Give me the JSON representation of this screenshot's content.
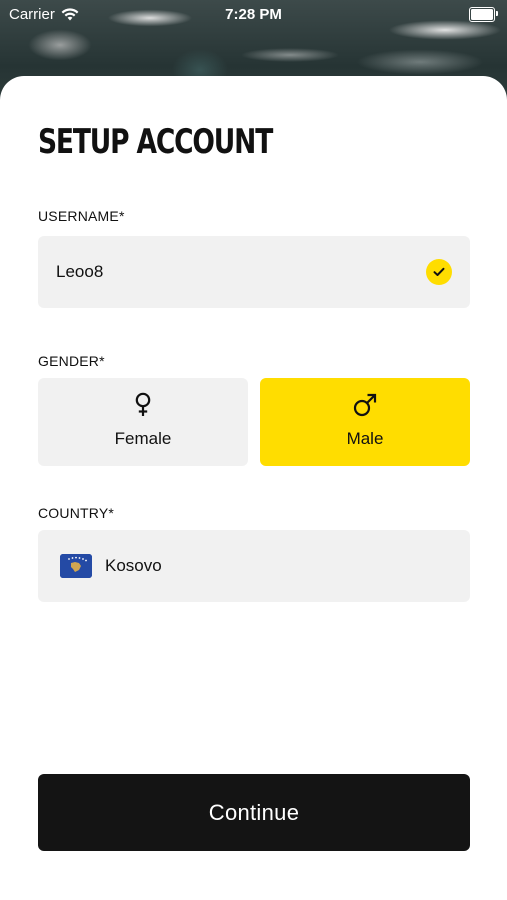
{
  "status_bar": {
    "carrier": "Carrier",
    "time": "7:28 PM",
    "wifi_icon": "wifi-icon",
    "battery_icon": "battery-icon"
  },
  "screen": {
    "title": "SETUP ACCOUNT"
  },
  "username": {
    "label": "USERNAME*",
    "value": "Leoo8",
    "status_icon": "check-circle-icon",
    "accent": "#FFDD00"
  },
  "gender": {
    "label": "GENDER*",
    "options": [
      {
        "label": "Female",
        "icon": "female-symbol-icon",
        "selected": false
      },
      {
        "label": "Male",
        "icon": "male-symbol-icon",
        "selected": true
      }
    ]
  },
  "country": {
    "label": "COUNTRY*",
    "value": "Kosovo",
    "flag_icon": "kosovo-flag-icon"
  },
  "continue_button": {
    "label": "Continue"
  },
  "colors": {
    "accent": "#FFDD00",
    "field_bg": "#F1F1F1",
    "button_bg": "#141414",
    "text": "#111111"
  }
}
